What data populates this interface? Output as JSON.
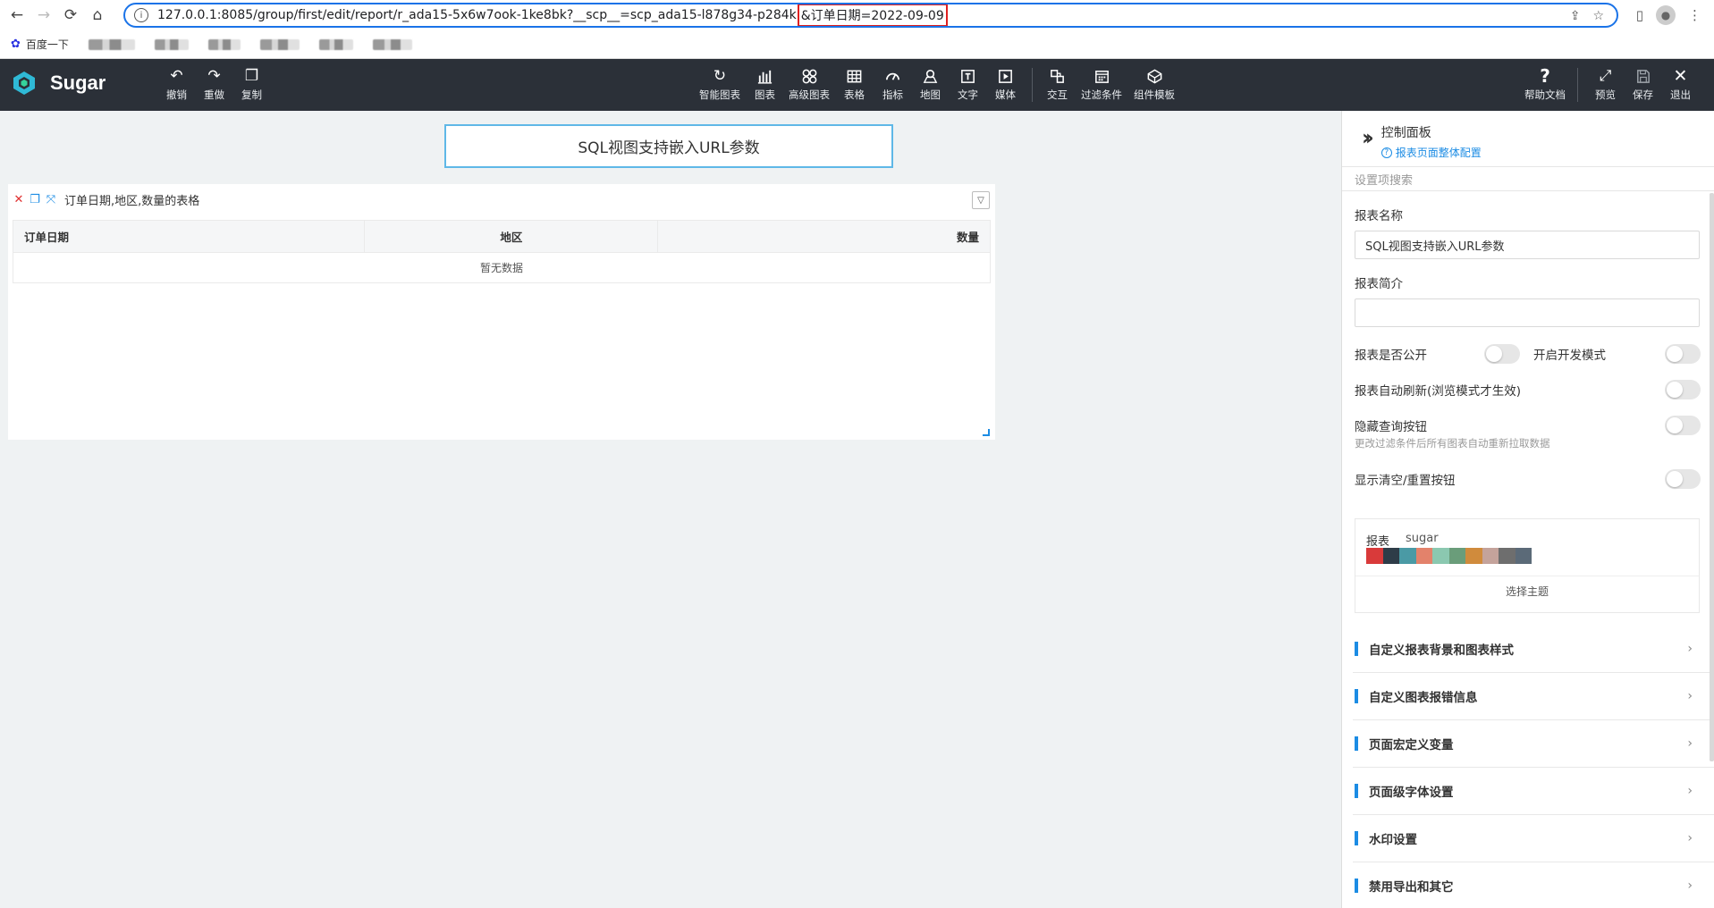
{
  "browser": {
    "url_host": "127.0.0.1",
    "url_rest": ":8085/group/first/edit/report/r_ada15-5x6w7ook-1ke8bk?__scp__=scp_ada15-l878g34-p284k",
    "url_highlight": "&订单日期=2022-09-09",
    "bookmark_baidu": "百度一下"
  },
  "app": {
    "name": "Sugar",
    "toolbar_left": [
      {
        "label": "撤销",
        "icon": "undo-icon"
      },
      {
        "label": "重做",
        "icon": "redo-icon"
      },
      {
        "label": "复制",
        "icon": "copy-icon"
      }
    ],
    "toolbar_center": [
      {
        "label": "智能图表",
        "icon": "smart-chart-icon"
      },
      {
        "label": "图表",
        "icon": "bar-chart-icon"
      },
      {
        "label": "高级图表",
        "icon": "advanced-chart-icon"
      },
      {
        "label": "表格",
        "icon": "table-icon"
      },
      {
        "label": "指标",
        "icon": "gauge-icon"
      },
      {
        "label": "地图",
        "icon": "map-pin-icon"
      },
      {
        "label": "文字",
        "icon": "text-icon"
      },
      {
        "label": "媒体",
        "icon": "media-icon"
      },
      {
        "label": "交互",
        "icon": "interaction-icon"
      },
      {
        "label": "过滤条件",
        "icon": "filter-icon"
      },
      {
        "label": "组件模板",
        "icon": "template-icon"
      }
    ],
    "toolbar_right": [
      {
        "label": "帮助文档",
        "icon": "help-icon"
      },
      {
        "label": "预览",
        "icon": "expand-icon"
      },
      {
        "label": "保存",
        "icon": "save-icon"
      },
      {
        "label": "退出",
        "icon": "close-icon"
      }
    ]
  },
  "canvas": {
    "report_title": "SQL视图支持嵌入URL参数",
    "widget": {
      "title": "订单日期,地区,数量的表格",
      "columns": [
        "订单日期",
        "地区",
        "数量"
      ],
      "empty_text": "暂无数据"
    }
  },
  "panel": {
    "title": "控制面板",
    "subtitle": "报表页面整体配置",
    "search_placeholder": "设置项搜索",
    "report_name_label": "报表名称",
    "report_name_value": "SQL视图支持嵌入URL参数",
    "report_desc_label": "报表简介",
    "report_desc_value": "",
    "public_label": "报表是否公开",
    "dev_mode_label": "开启开发模式",
    "auto_refresh_label": "报表自动刷新(浏览模式才生效)",
    "hide_query_label": "隐藏查询按钮",
    "hide_query_hint": "更改过滤条件后所有图表自动重新拉取数据",
    "show_reset_label": "显示清空/重置按钮",
    "theme": {
      "label": "报表",
      "name": "sugar",
      "colors": [
        "#d93a3a",
        "#2e3c48",
        "#4a9aa5",
        "#e3826b",
        "#8bc8b0",
        "#6a9d7a",
        "#d08b3c",
        "#c4a39b",
        "#6e6e6e",
        "#5b6a78"
      ],
      "button": "选择主题"
    },
    "sections": [
      "自定义报表背景和图表样式",
      "自定义图表报错信息",
      "页面宏定义变量",
      "页面级字体设置",
      "水印设置",
      "禁用导出和其它"
    ]
  }
}
